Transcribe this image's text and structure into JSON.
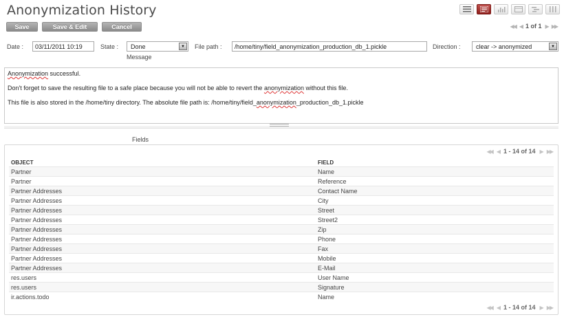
{
  "page": {
    "title": "Anonymization History"
  },
  "toolbar": {
    "save_label": "Save",
    "save_edit_label": "Save & Edit",
    "cancel_label": "Cancel",
    "pager": "1 of 1"
  },
  "view_modes": [
    "list-view-icon",
    "form-view-icon",
    "graph-view-icon",
    "calendar-view-icon",
    "gantt-view-icon",
    "kanban-view-icon"
  ],
  "form": {
    "date_label": "Date :",
    "date_value": "03/11/2011 10:19",
    "state_label": "State :",
    "state_value": "Done",
    "filepath_label": "File path :",
    "filepath_value": "/home/tiny/field_anonymization_production_db_1.pickle",
    "direction_label": "Direction :",
    "direction_value": "clear -> anonymized",
    "message_label": "Message"
  },
  "message": {
    "line1_word": "Anonymization",
    "line1_rest": " successful.",
    "line2_pre": "Don't forget to save the resulting file to a safe place because you will not be able to revert the ",
    "line2_word": "anonymization",
    "line2_post": " without this file.",
    "line3_pre": "This file is also stored in the /home/tiny directory. The absolute file path is: /home/tiny/field_",
    "line3_word": "anonymization",
    "line3_post": "_production_db_1.pickle"
  },
  "fields": {
    "caption": "Fields",
    "pager": "1 - 14 of 14",
    "columns": {
      "object": "OBJECT",
      "field": "FIELD"
    },
    "rows": [
      {
        "object": "Partner",
        "field": "Name"
      },
      {
        "object": "Partner",
        "field": "Reference"
      },
      {
        "object": "Partner Addresses",
        "field": "Contact Name"
      },
      {
        "object": "Partner Addresses",
        "field": "City"
      },
      {
        "object": "Partner Addresses",
        "field": "Street"
      },
      {
        "object": "Partner Addresses",
        "field": "Street2"
      },
      {
        "object": "Partner Addresses",
        "field": "Zip"
      },
      {
        "object": "Partner Addresses",
        "field": "Phone"
      },
      {
        "object": "Partner Addresses",
        "field": "Fax"
      },
      {
        "object": "Partner Addresses",
        "field": "Mobile"
      },
      {
        "object": "Partner Addresses",
        "field": "E-Mail"
      },
      {
        "object": "res.users",
        "field": "User Name"
      },
      {
        "object": "res.users",
        "field": "Signature"
      },
      {
        "object": "ir.actions.todo",
        "field": "Name"
      }
    ]
  },
  "colors": {
    "accent": "#a52a27",
    "button": "#9a9a9a"
  }
}
